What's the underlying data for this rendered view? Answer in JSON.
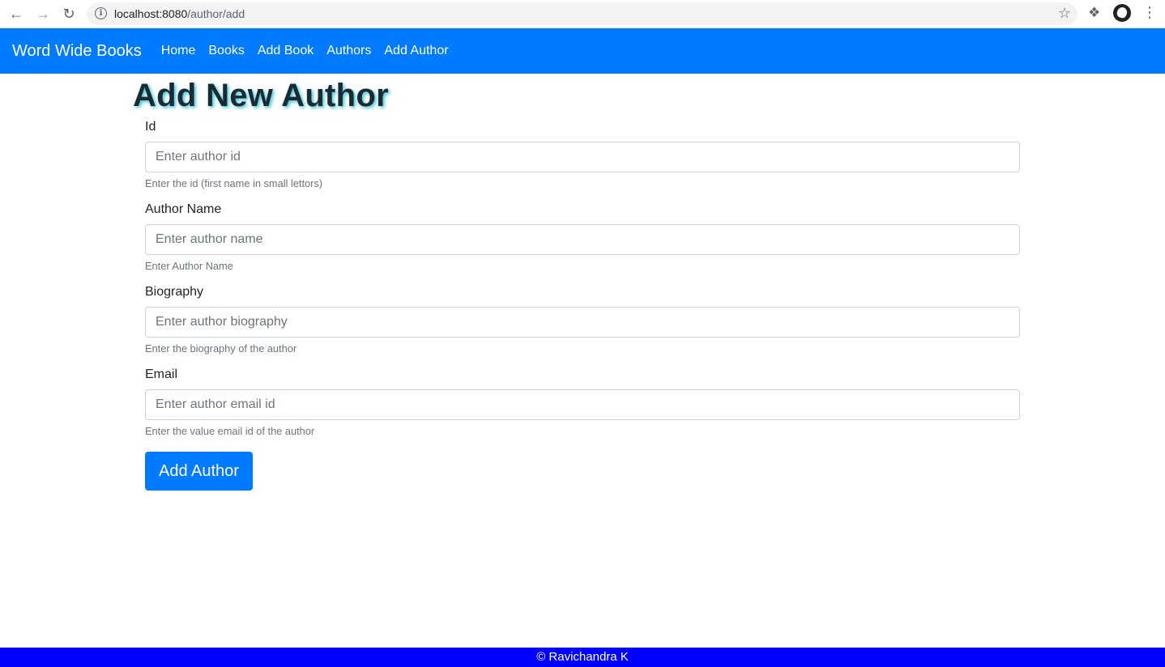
{
  "browser": {
    "url_host": "localhost:8080",
    "url_path": "/author/add",
    "icons": [
      "back-icon",
      "forward-icon",
      "reload-icon",
      "info-icon",
      "star-icon",
      "extensions-icon",
      "menu-icon"
    ]
  },
  "navbar": {
    "brand": "Word Wide Books",
    "links": [
      {
        "label": "Home"
      },
      {
        "label": "Books"
      },
      {
        "label": "Add Book"
      },
      {
        "label": "Authors"
      },
      {
        "label": "Add Author"
      }
    ],
    "color": "#007bff"
  },
  "page": {
    "title": "Add New Author"
  },
  "form": {
    "fields": [
      {
        "label": "Id",
        "placeholder": "Enter author id",
        "help": "Enter the id (first name in small lettors)"
      },
      {
        "label": "Author Name",
        "placeholder": "Enter author name",
        "help": "Enter Author Name"
      },
      {
        "label": "Biography",
        "placeholder": "Enter author biography",
        "help": "Enter the biography of the author"
      },
      {
        "label": "Email",
        "placeholder": "Enter author email id",
        "help": "Enter the value email id of the author"
      }
    ],
    "submit_label": "Add Author"
  },
  "footer": {
    "text": "© Ravichandra K",
    "color": "#0000ff"
  }
}
